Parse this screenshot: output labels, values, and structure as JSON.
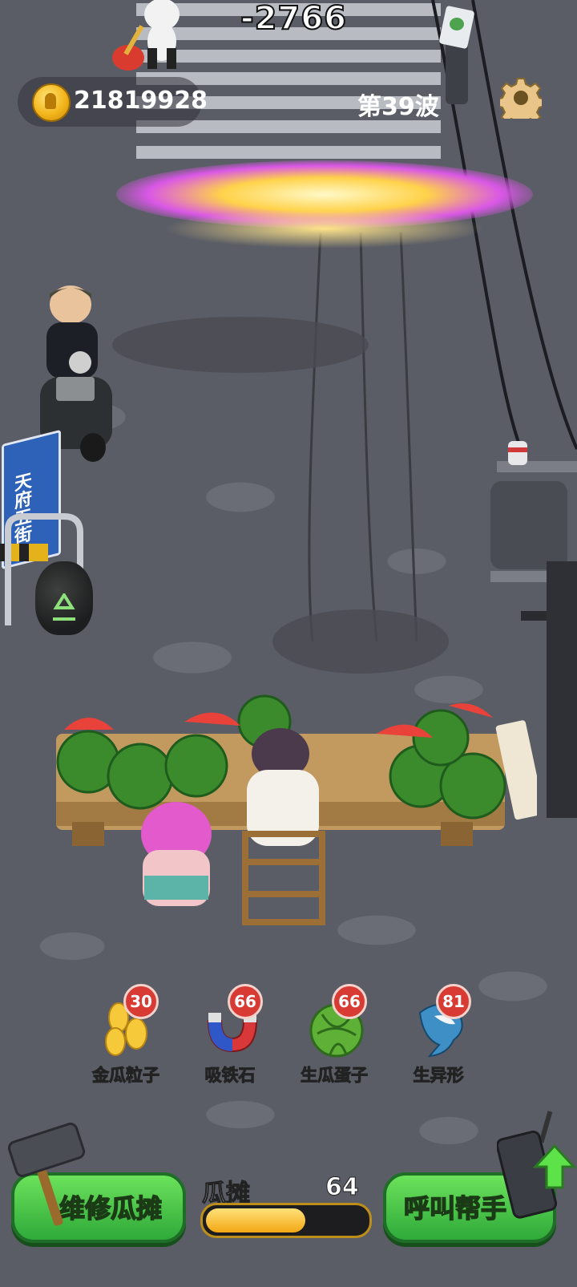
{
  "hud": {
    "coins": "21819928",
    "wave": "第39波",
    "damage_text": "-2766"
  },
  "street_sign": "天府五街",
  "powerups": [
    {
      "label": "金瓜粒子",
      "count": "30",
      "icon": "golden-seeds-icon"
    },
    {
      "label": "吸铁石",
      "count": "66",
      "icon": "magnet-icon"
    },
    {
      "label": "生瓜蛋子",
      "count": "66",
      "icon": "green-melon-icon"
    },
    {
      "label": "生异形",
      "count": "81",
      "icon": "alien-shark-icon"
    }
  ],
  "bottom": {
    "repair_label": "维修瓜摊",
    "stall_label": "瓜摊",
    "stall_value": "64",
    "stall_fill": 0.62,
    "help_label": "呼叫帮手"
  },
  "colors": {
    "button_green": "#3fbf45",
    "badge_red": "#d83b33",
    "progress_gold": "#f4a713"
  }
}
